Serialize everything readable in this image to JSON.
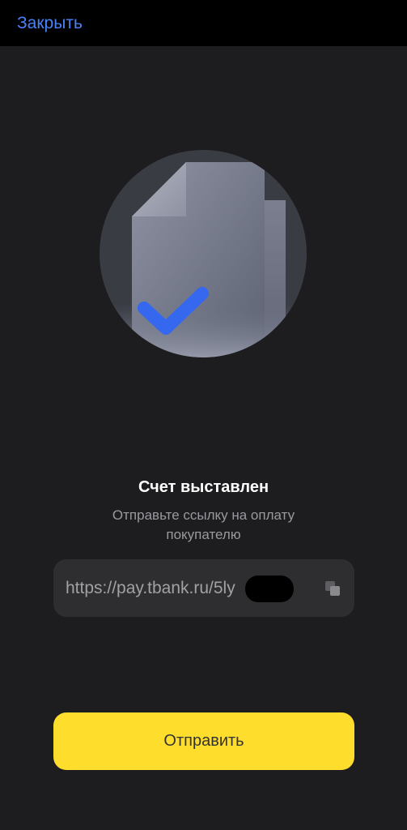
{
  "header": {
    "close_label": "Закрыть"
  },
  "illustration": {
    "icon": "invoice-document-check-icon"
  },
  "main": {
    "title": "Счет выставлен",
    "subtitle": "Отправьте ссылку на оплату покупателю"
  },
  "link_field": {
    "value": "https://pay.tbank.ru/5ly",
    "copy_icon": "copy-icon"
  },
  "actions": {
    "send_label": "Отправить"
  },
  "colors": {
    "background": "#1d1c1f",
    "topbar": "#000000",
    "link_accent": "#4a82f5",
    "field_background": "#2e2e31",
    "primary_button": "#ffdd2d",
    "check_mark": "#3568ee"
  }
}
